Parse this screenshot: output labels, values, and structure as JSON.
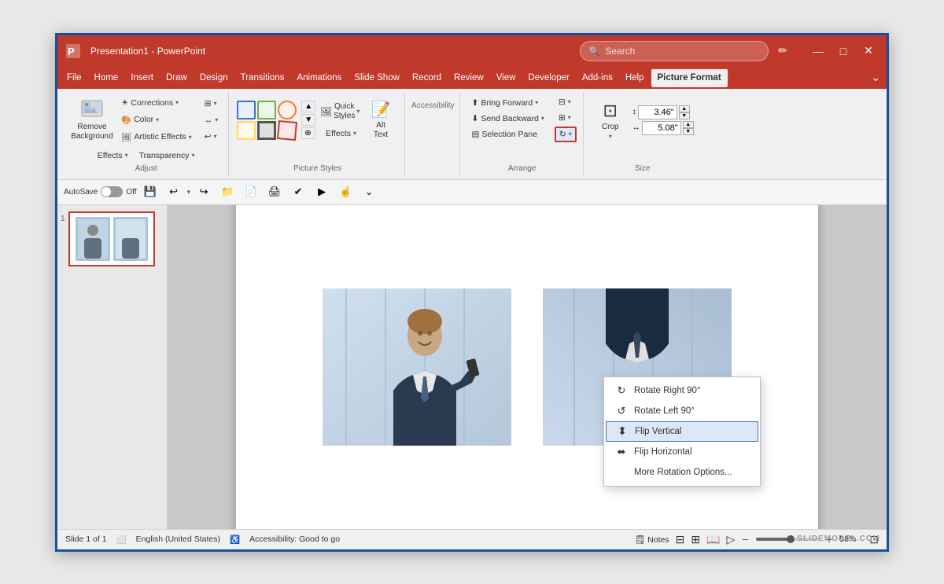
{
  "titleBar": {
    "appName": "Presentation1 - PowerPoint",
    "searchPlaceholder": "Search",
    "minimize": "—",
    "maximize": "□",
    "close": "✕",
    "penIcon": "✏"
  },
  "menuBar": {
    "items": [
      {
        "label": "File"
      },
      {
        "label": "Home"
      },
      {
        "label": "Insert"
      },
      {
        "label": "Draw"
      },
      {
        "label": "Design"
      },
      {
        "label": "Transitions"
      },
      {
        "label": "Animations"
      },
      {
        "label": "Slide Show"
      },
      {
        "label": "Record"
      },
      {
        "label": "Review"
      },
      {
        "label": "View"
      },
      {
        "label": "Developer"
      },
      {
        "label": "Add-ins"
      },
      {
        "label": "Help"
      },
      {
        "label": "Picture Format",
        "active": true
      }
    ]
  },
  "ribbon": {
    "groups": {
      "adjust": {
        "label": "Adjust",
        "removeBackground": "Remove\nBackground",
        "corrections": "Corrections",
        "color": "Color",
        "artisticEffects": "Artistic Effects",
        "transparency": "Transparency",
        "moreIcon": "▣"
      },
      "pictureStyles": {
        "label": "Picture Styles",
        "quickStyles": "Quick\nStyles",
        "effects": "Effects",
        "altText": "Alt\nText"
      },
      "accessibility": {
        "label": "Accessibility"
      },
      "arrange": {
        "label": "Arrange",
        "bringForward": "Bring Forward",
        "sendBackward": "Send Backward",
        "selectionPane": "Selection Pane",
        "rotateBtn": "↻"
      },
      "crop": {
        "label": "Crop",
        "cropBtn": "Crop",
        "height": "3.46\"",
        "width": "5.08\""
      }
    }
  },
  "toolbar": {
    "autosave": "AutoSave",
    "off": "Off"
  },
  "dropdown": {
    "items": [
      {
        "label": "Rotate Right 90°",
        "icon": "↻"
      },
      {
        "label": "Rotate Left 90°",
        "icon": "↺"
      },
      {
        "label": "Flip Vertical",
        "icon": "⬍",
        "selected": true
      },
      {
        "label": "Flip Horizontal",
        "icon": "⬌"
      },
      {
        "label": "More Rotation Options...",
        "icon": ""
      }
    ]
  },
  "statusBar": {
    "slide": "Slide 1 of 1",
    "language": "English (United States)",
    "accessibility": "Accessibility: Good to go",
    "notes": "Notes",
    "zoom": "58%"
  },
  "watermark": "SLIDEMODEL.COM"
}
